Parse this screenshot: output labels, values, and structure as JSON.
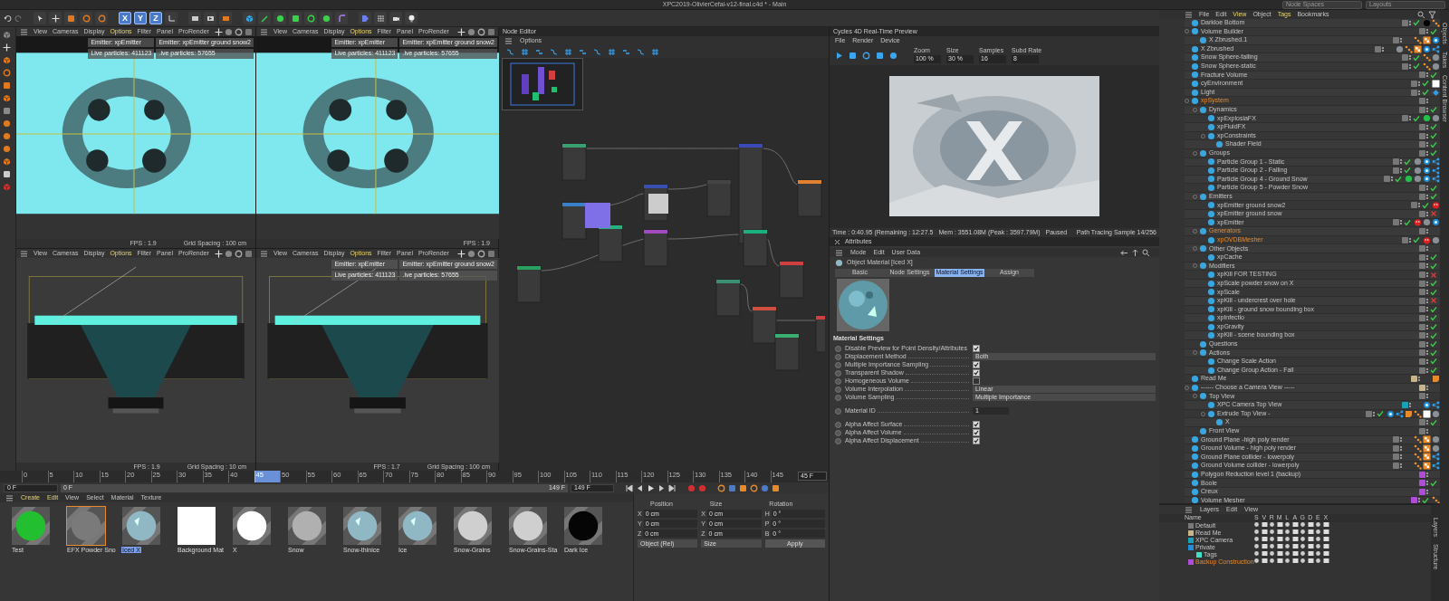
{
  "window": {
    "title": "XPC2019-OlivierCefai-v12-final.c4d * - Main",
    "dropdowns": [
      "Node Spaces",
      "Layouts"
    ]
  },
  "toolbar": {
    "axis_buttons": [
      {
        "label": "X",
        "selected": true
      },
      {
        "label": "Y",
        "selected": true
      },
      {
        "label": "Z",
        "selected": true
      }
    ]
  },
  "viewports": [
    {
      "kind": "top",
      "menu": [
        {
          "label": "View",
          "highlighted": false
        },
        {
          "label": "Cameras",
          "highlighted": false
        },
        {
          "label": "Display",
          "highlighted": false
        },
        {
          "label": "Options",
          "highlighted": true
        },
        {
          "label": "Filter",
          "highlighted": false
        },
        {
          "label": "Panel",
          "highlighted": false
        },
        {
          "label": "ProRender",
          "highlighted": false
        }
      ],
      "badges": [
        "Emitter: xpEmitter",
        "Emitter: xpEmitter ground snow2",
        "Live particles: 411123",
        ".ive particles: 57655"
      ],
      "footer": [
        "FPS : 1.9",
        "Grid Spacing : 100 cm"
      ]
    },
    {
      "kind": "top",
      "menu": [
        {
          "label": "View",
          "highlighted": false
        },
        {
          "label": "Cameras",
          "highlighted": false
        },
        {
          "label": "Display",
          "highlighted": false
        },
        {
          "label": "Options",
          "highlighted": true
        },
        {
          "label": "Filter",
          "highlighted": false
        },
        {
          "label": "Panel",
          "highlighted": false
        },
        {
          "label": "ProRender",
          "highlighted": false
        }
      ],
      "badges": [
        "Emitter: xpEmitter",
        "Emitter: xpEmitter ground snow2",
        "Live particles: 411123",
        ".ive particles: 57655"
      ],
      "footer": [
        "FPS : 1.9"
      ]
    },
    {
      "kind": "front",
      "menu": [
        {
          "label": "View",
          "highlighted": false
        },
        {
          "label": "Cameras",
          "highlighted": false
        },
        {
          "label": "Display",
          "highlighted": false
        },
        {
          "label": "Options",
          "highlighted": true
        },
        {
          "label": "Filter",
          "highlighted": false
        },
        {
          "label": "Panel",
          "highlighted": false
        },
        {
          "label": "ProRender",
          "highlighted": false
        }
      ],
      "footer": [
        "FPS : 1.9",
        "Grid Spacing : 10 cm"
      ]
    },
    {
      "kind": "front",
      "menu": [
        {
          "label": "View",
          "highlighted": false
        },
        {
          "label": "Cameras",
          "highlighted": false
        },
        {
          "label": "Display",
          "highlighted": false
        },
        {
          "label": "Options",
          "highlighted": true
        },
        {
          "label": "Filter",
          "highlighted": false
        },
        {
          "label": "Panel",
          "highlighted": false
        },
        {
          "label": "ProRender",
          "highlighted": false
        }
      ],
      "badges": [
        "Emitter: xpEmitter",
        "Emitter: xpEmitter ground snow2",
        "Live particles: 411123",
        ".ive particles: 57655"
      ],
      "footer": [
        "FPS : 1.7",
        "Grid Spacing : 100 cm"
      ]
    }
  ],
  "node_editor": {
    "title": "Node Editor",
    "menu": [
      "Options"
    ]
  },
  "render_view": {
    "title": "Cycles 4D Real-Time Preview",
    "menu": [
      "File",
      "Render",
      "Device"
    ],
    "fields": [
      {
        "label": "Zoom",
        "value": "100 %"
      },
      {
        "label": "Size",
        "value": "30 %"
      },
      {
        "label": "Samples",
        "value": "16"
      },
      {
        "label": "Subd Rate",
        "value": "8"
      }
    ],
    "status": [
      "Time : 0:40.95 (Remaining : 12:27.5",
      "Mem : 3551.08M (Peak : 3597.79M)",
      "Paused"
    ],
    "sample": "Path Tracing Sample 14/256"
  },
  "attributes": {
    "title": "Attributes",
    "menu": [
      "Mode",
      "Edit",
      "User Data"
    ],
    "object": "Object Material [Iced X]",
    "tabs": [
      {
        "label": "Basic",
        "selected": false
      },
      {
        "label": "Node Settings",
        "selected": false
      },
      {
        "label": "Material Settings",
        "selected": true
      },
      {
        "label": "Assign",
        "selected": false
      }
    ],
    "section": "Material Settings",
    "groups": [
      [
        {
          "kind": "check",
          "label": "Disable Preview for Point Density/Attributes",
          "checked": true
        },
        {
          "kind": "dropdown",
          "label": "Displacement Method",
          "value": "Both"
        },
        {
          "kind": "check",
          "label": "Multiple Importance Sampling",
          "checked": true
        },
        {
          "kind": "check",
          "label": "Transparent Shadow",
          "checked": true
        },
        {
          "kind": "check",
          "label": "Homogeneous Volume",
          "checked": false
        },
        {
          "kind": "dropdown",
          "label": "Volume Interpolation",
          "value": "Linear"
        },
        {
          "kind": "dropdown",
          "label": "Volume Sampling",
          "value": "Multiple Importance"
        }
      ],
      [
        {
          "kind": "number",
          "label": "Material ID",
          "value": "1"
        }
      ],
      [
        {
          "kind": "check",
          "label": "Alpha Affect Surface",
          "checked": true
        },
        {
          "kind": "check",
          "label": "Alpha Affect Volume",
          "checked": true
        },
        {
          "kind": "check",
          "label": "Alpha Affect Displacement",
          "checked": true
        }
      ]
    ]
  },
  "timeline": {
    "ticks": [
      "0",
      "5",
      "10",
      "15",
      "20",
      "25",
      "30",
      "35",
      "40",
      "45",
      "50",
      "55",
      "60",
      "65",
      "70",
      "75",
      "80",
      "85",
      "90",
      "95",
      "100",
      "105",
      "110",
      "115",
      "120",
      "125",
      "130",
      "135",
      "140",
      "145"
    ],
    "level": 0.31,
    "current_frame": "45 F",
    "start": "0 F",
    "range_start": "0 F",
    "range_end": "149 F",
    "end": "149 F"
  },
  "materials": {
    "menu": [
      {
        "label": "Create",
        "highlighted": true
      },
      {
        "label": "Edit",
        "highlighted": true
      },
      {
        "label": "View",
        "highlighted": false
      },
      {
        "label": "Select",
        "highlighted": false
      },
      {
        "label": "Material",
        "highlighted": false
      },
      {
        "label": "Texture",
        "highlighted": false
      }
    ],
    "items": [
      {
        "name": "Test",
        "kind": "green",
        "selected": false,
        "renaming": false
      },
      {
        "name": "EFX Powder Sno",
        "kind": "grey",
        "selected": true,
        "renaming": false
      },
      {
        "name": "Iced X",
        "kind": "ice",
        "selected": false,
        "renaming": true
      },
      {
        "name": "Background Mat",
        "kind": "flat",
        "selected": false,
        "renaming": false
      },
      {
        "name": "X",
        "kind": "white",
        "selected": false,
        "renaming": false
      },
      {
        "name": "Snow",
        "kind": "snow",
        "selected": false,
        "renaming": false
      },
      {
        "name": "Snow-thinice",
        "kind": "ice",
        "selected": false,
        "renaming": false
      },
      {
        "name": "Ice",
        "kind": "ice",
        "selected": false,
        "renaming": false
      },
      {
        "name": "Snow-Grains",
        "kind": "light",
        "selected": false,
        "renaming": false
      },
      {
        "name": "Snow-Grains-Sta",
        "kind": "light",
        "selected": false,
        "renaming": false
      },
      {
        "name": "Dark Ice",
        "kind": "dark",
        "selected": false,
        "renaming": false
      }
    ]
  },
  "coordinates": {
    "headers": [
      "Position",
      "Size",
      "Rotation"
    ],
    "rows": [
      [
        {
          "axis": "X",
          "value": "0 cm"
        },
        {
          "axis": "X",
          "value": "0 cm"
        },
        {
          "axis": "H",
          "value": "0 °"
        }
      ],
      [
        {
          "axis": "Y",
          "value": "0 cm"
        },
        {
          "axis": "Y",
          "value": "0 cm"
        },
        {
          "axis": "P",
          "value": "0 °"
        }
      ],
      [
        {
          "axis": "Z",
          "value": "0 cm"
        },
        {
          "axis": "Z",
          "value": "0 cm"
        },
        {
          "axis": "B",
          "value": "0 °"
        }
      ]
    ],
    "dropdowns": [
      "Object (Rel)",
      "Size"
    ],
    "apply": "Apply"
  },
  "objects": {
    "menu": [
      {
        "label": "File",
        "highlighted": false
      },
      {
        "label": "Edit",
        "highlighted": false
      },
      {
        "label": "View",
        "highlighted": true
      },
      {
        "label": "Object",
        "highlighted": false
      },
      {
        "label": "Tags",
        "highlighted": true
      },
      {
        "label": "Bookmarks",
        "highlighted": false
      }
    ],
    "side_tabs": [
      "Objects",
      "Takes",
      "Content Browser"
    ],
    "rows": [
      {
        "name": "Darkloe Bottom",
        "selected": false,
        "enabled": true,
        "tags": [
          {
            "kind": "black"
          },
          {
            "kind": "dots"
          }
        ]
      },
      {
        "name": "Volume Builder",
        "selected": false,
        "enabled": true,
        "children": [
          {
            "name": "X Zbrushed.1",
            "selected": false,
            "tags": [
              {
                "kind": "dots"
              },
              {
                "kind": "checker"
              },
              {
                "kind": "target"
              }
            ]
          }
        ]
      },
      {
        "name": "X Zbrushed",
        "selected": false,
        "tags": [
          {
            "kind": "material"
          },
          {
            "kind": "dots"
          },
          {
            "kind": "checker"
          },
          {
            "kind": "target"
          },
          {
            "kind": "share"
          }
        ]
      },
      {
        "name": "Snow Sphere-falling",
        "selected": false,
        "enabled": true,
        "tags": [
          {
            "kind": "dots"
          },
          {
            "kind": "material"
          }
        ]
      },
      {
        "name": "Snow Sphere-static",
        "selected": false,
        "enabled": true,
        "tags": [
          {
            "kind": "dots"
          },
          {
            "kind": "material"
          }
        ]
      },
      {
        "name": "Fracture Volume",
        "selected": false,
        "enabled": true
      },
      {
        "name": "cyEnvironment",
        "selected": false,
        "enabled": true,
        "tags": [
          {
            "kind": "white"
          }
        ]
      },
      {
        "name": "Light",
        "selected": false,
        "enabled": true,
        "tags": [
          {
            "kind": "light"
          }
        ]
      },
      {
        "name": "xpSystem",
        "selected": true,
        "children": [
          {
            "name": "Dynamics",
            "selected": false,
            "enabled": true,
            "children": [
              {
                "name": "xpExplosiaFX",
                "selected": false,
                "enabled": true,
                "tags": [
                  {
                    "kind": "green"
                  },
                  {
                    "kind": "material"
                  }
                ]
              },
              {
                "name": "xpFluidFX",
                "selected": false,
                "enabled": true
              },
              {
                "name": "xpConstraints",
                "selected": false,
                "enabled": true,
                "children": [
                  {
                    "name": "Shader Field",
                    "selected": false,
                    "enabled": true
                  }
                ]
              }
            ]
          },
          {
            "name": "Groups",
            "selected": false,
            "enabled": true,
            "children": [
              {
                "name": "Particle Group 1 - Static",
                "selected": false,
                "enabled": true,
                "tags": [
                  {
                    "kind": "material"
                  },
                  {
                    "kind": "target"
                  },
                  {
                    "kind": "share"
                  }
                ]
              },
              {
                "name": "Particle Group 2 - Falling",
                "selected": false,
                "enabled": true,
                "tags": [
                  {
                    "kind": "material"
                  },
                  {
                    "kind": "target"
                  },
                  {
                    "kind": "share"
                  }
                ]
              },
              {
                "name": "Particle Group 4 - Ground Snow",
                "selected": false,
                "enabled": true,
                "tags": [
                  {
                    "kind": "green"
                  },
                  {
                    "kind": "material"
                  },
                  {
                    "kind": "target"
                  },
                  {
                    "kind": "share"
                  }
                ]
              },
              {
                "name": "Particle Group 5 - Powder Snow",
                "selected": false,
                "enabled": true
              }
            ]
          },
          {
            "name": "Emitters",
            "selected": false,
            "enabled": true,
            "children": [
              {
                "name": "xpEmitter ground snow2",
                "selected": false,
                "enabled": true,
                "tags": [
                  {
                    "kind": "red"
                  }
                ]
              },
              {
                "name": "xpEmitter ground snow",
                "selected": false,
                "enabled": false
              },
              {
                "name": "xpEmitter",
                "selected": false,
                "enabled": true,
                "tags": [
                  {
                    "kind": "red"
                  },
                  {
                    "kind": "material"
                  },
                  {
                    "kind": "target"
                  }
                ]
              }
            ]
          },
          {
            "name": "Generators",
            "selected": true,
            "children": [
              {
                "name": "xpOVDBMesher",
                "selected": true,
                "enabled": true,
                "tags": [
                  {
                    "kind": "red"
                  },
                  {
                    "kind": "material"
                  }
                ]
              }
            ]
          },
          {
            "name": "Other Objects",
            "selected": false,
            "children": [
              {
                "name": "xpCache",
                "selected": false,
                "enabled": true
              }
            ]
          },
          {
            "name": "Modifiers",
            "selected": false,
            "enabled": true,
            "children": [
              {
                "name": "xpKill FOR TESTING",
                "selected": false,
                "enabled": false
              },
              {
                "name": "xpScale powder snow on X",
                "selected": false,
                "enabled": true
              },
              {
                "name": "xpScale",
                "selected": false,
                "enabled": true
              },
              {
                "name": "xpKill - undercrest over hole",
                "selected": false,
                "enabled": false
              },
              {
                "name": "xpKill - ground snow bounding box",
                "selected": false,
                "enabled": true
              },
              {
                "name": "xpInfectio",
                "selected": false,
                "enabled": true
              },
              {
                "name": "xpGravity",
                "selected": false,
                "enabled": true
              },
              {
                "name": "xpKill - scene bounding box",
                "selected": false,
                "enabled": true
              }
            ]
          },
          {
            "name": "Questions",
            "selected": false,
            "enabled": true
          },
          {
            "name": "Actions",
            "selected": false,
            "enabled": true,
            "children": [
              {
                "name": "Change Scale Action",
                "selected": false,
                "enabled": true
              },
              {
                "name": "Change Group Action - Fall",
                "selected": false,
                "enabled": true
              }
            ]
          }
        ]
      },
      {
        "name": "Read Me",
        "selected": false,
        "layer": {
          "color": "#c8b48a"
        },
        "tags": [
          {
            "kind": "note"
          }
        ]
      },
      {
        "name": "------ Choose a Camera View -----",
        "selected": false,
        "layer": {
          "color": "#c8b48a"
        },
        "children": [
          {
            "name": "Top View",
            "selected": false,
            "children": [
              {
                "name": "XPC Camera Top View",
                "selected": false,
                "layer": {
                  "color": "#17a2b8"
                },
                "tags": [
                  {
                    "kind": "target"
                  },
                  {
                    "kind": "share"
                  }
                ]
              },
              {
                "name": "Extrude Top View -",
                "selected": false,
                "enabled": true,
                "tags": [
                  {
                    "kind": "target"
                  },
                  {
                    "kind": "share"
                  },
                  {
                    "kind": "note"
                  },
                  {
                    "kind": "dots"
                  },
                  {
                    "kind": "white"
                  },
                  {
                    "kind": "material"
                  }
                ],
                "children": [
                  {
                    "name": "X",
                    "selected": false,
                    "enabled": true
                  }
                ]
              }
            ]
          },
          {
            "name": "Front View",
            "selected": false
          }
        ]
      },
      {
        "name": "Ground Plane -high poly render",
        "selected": false,
        "tags": [
          {
            "kind": "dots"
          },
          {
            "kind": "checker"
          },
          {
            "kind": "material"
          }
        ]
      },
      {
        "name": "Ground Volume - high poly render",
        "selected": false,
        "tags": [
          {
            "kind": "dots"
          },
          {
            "kind": "checker"
          },
          {
            "kind": "material"
          }
        ]
      },
      {
        "name": "Ground Plane collider - lowerpoly",
        "selected": false,
        "tags": [
          {
            "kind": "dots"
          },
          {
            "kind": "checker"
          },
          {
            "kind": "share"
          }
        ]
      },
      {
        "name": "Ground Volume collider - lowerpoly",
        "selected": false,
        "tags": [
          {
            "kind": "dots"
          },
          {
            "kind": "checker"
          },
          {
            "kind": "share"
          }
        ]
      },
      {
        "name": "Polygon Reduction level 1 (backup)",
        "selected": false,
        "layer": {
          "color": "#b04cd8"
        }
      },
      {
        "name": "Boole",
        "selected": false,
        "layer": {
          "color": "#b04cd8"
        },
        "enabled": true
      },
      {
        "name": "Creux",
        "selected": false,
        "layer": {
          "color": "#b04cd8"
        }
      },
      {
        "name": "Volume Mesher",
        "selected": false,
        "layer": {
          "color": "#b04cd8"
        },
        "enabled": true,
        "tags": [
          {
            "kind": "dots"
          }
        ]
      }
    ]
  },
  "layers": {
    "menu": [
      "Layers",
      "Edit",
      "View"
    ],
    "side_tabs": [
      "Layers",
      "Structure"
    ],
    "columns": [
      "Name",
      "S",
      "V",
      "R",
      "M",
      "L",
      "A",
      "G",
      "D",
      "E",
      "X"
    ],
    "rows": [
      {
        "name": "Default",
        "color": "#7a7a7a",
        "selected": false
      },
      {
        "name": "Read Me",
        "color": "#c8b48a",
        "selected": false
      },
      {
        "name": "XPC Camera",
        "color": "#17a2b8",
        "selected": false
      },
      {
        "name": "Private",
        "color": "#1e8fd8",
        "selected": false,
        "children": [
          {
            "name": "Tags",
            "color": "#40e0c8",
            "selected": false
          }
        ]
      },
      {
        "name": "Backup Construction",
        "color": "#b04cd8",
        "selected": true
      }
    ]
  }
}
